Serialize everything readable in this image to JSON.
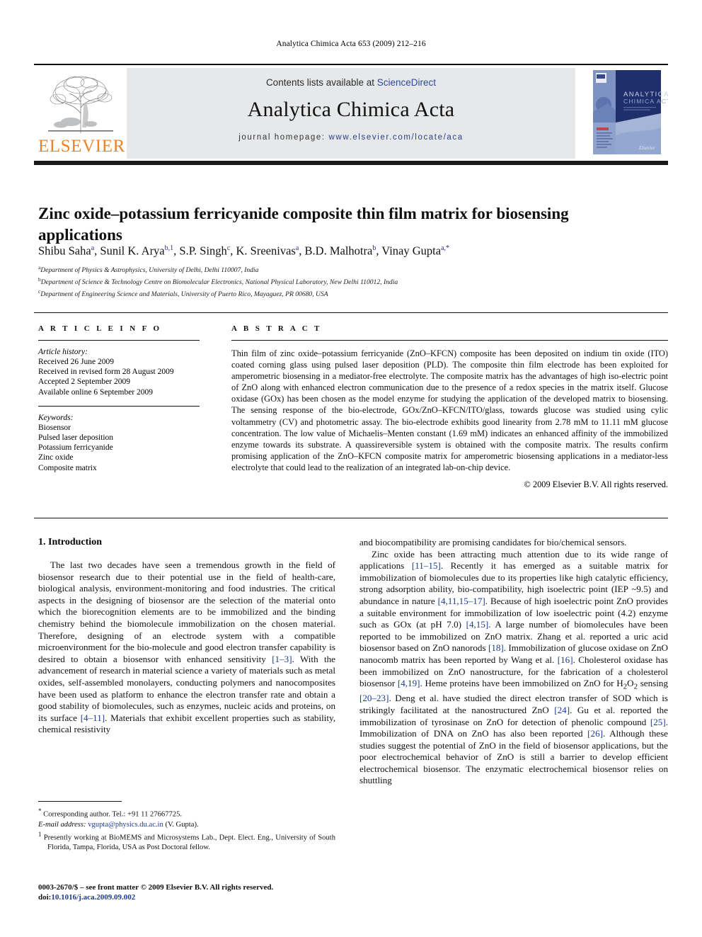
{
  "running_head": "Analytica Chimica Acta 653 (2009) 212–216",
  "journal_header": {
    "contents_prefix": "Contents lists available at ",
    "sciencedirect": "ScienceDirect",
    "journal_name": "Analytica Chimica Acta",
    "homepage_prefix": "journal homepage: ",
    "homepage_url": "www.elsevier.com/locate/aca",
    "publisher_logo_text": "ELSEVIER",
    "cover_title_line1": "ANALYTICA",
    "cover_title_line2": "CHIMICA ACTA",
    "link_color": "#2b4a9b",
    "logo_color": "#f08221",
    "panel_bg": "#e7e8ea"
  },
  "article": {
    "title": "Zinc oxide–potassium ferricyanide composite thin film matrix for biosensing applications",
    "authors_html": "Shibu Saha<sup>a</sup>, Sunil K. Arya<sup>b,1</sup>, S.P. Singh<sup>c</sup>, K. Sreenivas<sup>a</sup>, B.D. Malhotra<sup>b</sup>, Vinay Gupta<sup>a,*</sup>",
    "affiliations": [
      {
        "mark": "a",
        "text": "Department of Physics & Astrophysics, University of Delhi, Delhi 110007, India"
      },
      {
        "mark": "b",
        "text": "Department of Science & Technology Centre on Biomolecular Electronics, National Physical Laboratory, New Delhi 110012, India"
      },
      {
        "mark": "c",
        "text": "Department of Engineering Science and Materials, University of Puerto Rico, Mayaguez, PR 00680, USA"
      }
    ]
  },
  "article_info": {
    "heading": "A R T I C L E   I N F O",
    "history_title": "Article history:",
    "history": [
      "Received 26 June 2009",
      "Received in revised form 28 August 2009",
      "Accepted 2 September 2009",
      "Available online 6 September 2009"
    ],
    "keywords_title": "Keywords:",
    "keywords": [
      "Biosensor",
      "Pulsed laser deposition",
      "Potassium ferricyanide",
      "Zinc oxide",
      "Composite matrix"
    ]
  },
  "abstract": {
    "heading": "A B S T R A C T",
    "body": "Thin film of zinc oxide–potassium ferricyanide (ZnO–KFCN) composite has been deposited on indium tin oxide (ITO) coated corning glass using pulsed laser deposition (PLD). The composite thin film electrode has been exploited for amperometric biosensing in a mediator-free electrolyte. The composite matrix has the advantages of high iso-electric point of ZnO along with enhanced electron communication due to the presence of a redox species in the matrix itself. Glucose oxidase (GOx) has been chosen as the model enzyme for studying the application of the developed matrix to biosensing. The sensing response of the bio-electrode, GOx/ZnO–KFCN/ITO/glass, towards glucose was studied using cylic voltammetry (CV) and photometric assay. The bio-electrode exhibits good linearity from 2.78 mM to 11.11 mM glucose concentration. The low value of Michaelis–Menten constant (1.69 mM) indicates an enhanced affinity of the immobilized enzyme towards its substrate. A quassireversible system is obtained with the composite matrix. The results confirm promising application of the ZnO–KFCN composite matrix for amperometric biosensing applications in a mediator-less electrolyte that could lead to the realization of an integrated lab-on-chip device.",
    "copyright": "© 2009 Elsevier B.V. All rights reserved."
  },
  "body": {
    "section_heading": "1. Introduction",
    "left_para_1": "The last two decades have seen a tremendous growth in the field of biosensor research due to their potential use in the field of health-care, biological analysis, environment-monitoring and food industries. The critical aspects in the designing of biosensor are the selection of the material onto which the biorecognition elements are to be immobilized and the binding chemistry behind the biomolecule immobilization on the chosen material. Therefore, designing of an electrode system with a compatible microenvironment for the bio-molecule and good electron transfer capability is desired to obtain a biosensor with enhanced sensitivity [1–3]. With the advancement of research in material science a variety of materials such as metal oxides, self-assembled monolayers, conducting polymers and nanocomposites have been used as platform to enhance the electron transfer rate and obtain a good stability of biomolecules, such as enzymes, nucleic acids and proteins, on its surface [4–11]. Materials that exhibit excellent properties such as stability, chemical resistivity",
    "right_para_carryover": "and biocompatibility are promising candidates for bio/chemical sensors.",
    "right_para_2": "Zinc oxide has been attracting much attention due to its wide range of applications [11–15]. Recently it has emerged as a suitable matrix for immobilization of biomolecules due to its properties like high catalytic efficiency, strong adsorption ability, bio-compatibility, high isoelectric point (IEP ~9.5) and abundance in nature [4,11,15–17]. Because of high isoelectric point ZnO provides a suitable environment for immobilization of low isoelectric point (4.2) enzyme such as GOx (at pH 7.0) [4,15]. A large number of biomolecules have been reported to be immobilized on ZnO matrix. Zhang et al. reported a uric acid biosensor based on ZnO nanorods [18]. Immobilization of glucose oxidase on ZnO nanocomb matrix has been reported by Wang et al. [16]. Cholesterol oxidase has been immobilized on ZnO nanostructure, for the fabrication of a cholesterol biosensor [4,19]. Heme proteins have been immobilized on ZnO for H2O2 sensing [20–23]. Deng et al. have studied the direct electron transfer of SOD which is strikingly facilitated at the nanostructured ZnO [24]. Gu et al. reported the immobilization of tyrosinase on ZnO for detection of phenolic compound [25]. Immobilization of DNA on ZnO has also been reported [26]. Although these studies suggest the potential of ZnO in the field of biosensor applications, but the poor electrochemical behavior of ZnO is still a barrier to develop efficient electrochemical biosensor. The enzymatic electrochemical biosensor relies on shuttling"
  },
  "footnotes": {
    "corresponding_mark": "*",
    "corresponding_text": "Corresponding author. Tel.: +91 11 27667725.",
    "email_label": "E-mail address:",
    "email": "vgupta@physics.du.ac.in",
    "email_suffix": "(V. Gupta).",
    "note1_mark": "1",
    "note1_text": "Presently working at BioMEMS and Microsystems Lab., Dept. Elect. Eng., University of South Florida, Tampa, Florida, USA as Post Doctoral fellow.",
    "issn_line": "0003-2670/$ – see front matter © 2009 Elsevier B.V. All rights reserved.",
    "doi_label": "doi:",
    "doi_value": "10.1016/j.aca.2009.09.002"
  }
}
